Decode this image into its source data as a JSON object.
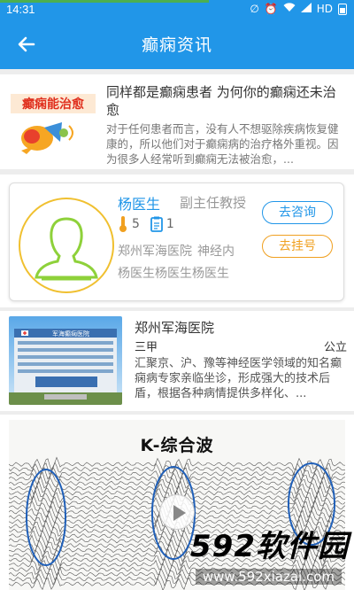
{
  "status_bar": {
    "time": "14:31",
    "network": "HD",
    "progress_fraction": 0.59
  },
  "header": {
    "title": "癫痫资讯",
    "back_icon": "arrow-left-icon"
  },
  "article": {
    "thumb_text": "癫痫能治愈",
    "title": "同样都是癫痫患者 为何你的癫痫还未治愈",
    "description": "对于任何患者而言，没有人不想驱除疾病恢复健康的，所以他们对于癫痫病的治疗格外重视。因为很多人经常听到癫痫无法被治愈，..."
  },
  "doctor": {
    "name": "杨医生",
    "title": "副主任教授",
    "rating": "5",
    "cases": "1",
    "hospital": "郑州军海医院",
    "department": "神经内",
    "specialty": "杨医生杨医生杨医生",
    "consult_label": "去咨询",
    "register_label": "去挂号"
  },
  "hospital": {
    "name": "郑州军海医院",
    "grade": "三甲",
    "type": "公立",
    "description": "汇聚京、沪、豫等神经医学领域的知名癫痫病专家亲临坐诊，形成强大的技术后盾，根据各种病情提供多样化、...",
    "sign_text": "军海癫痫医院"
  },
  "video": {
    "title": "K-综合波"
  },
  "watermark": {
    "brand": "592软件园",
    "url": "www.592xiazai.com"
  },
  "colors": {
    "primary": "#2196e8",
    "accent": "#f0a020",
    "avatar_outline": "#8ed13a"
  }
}
